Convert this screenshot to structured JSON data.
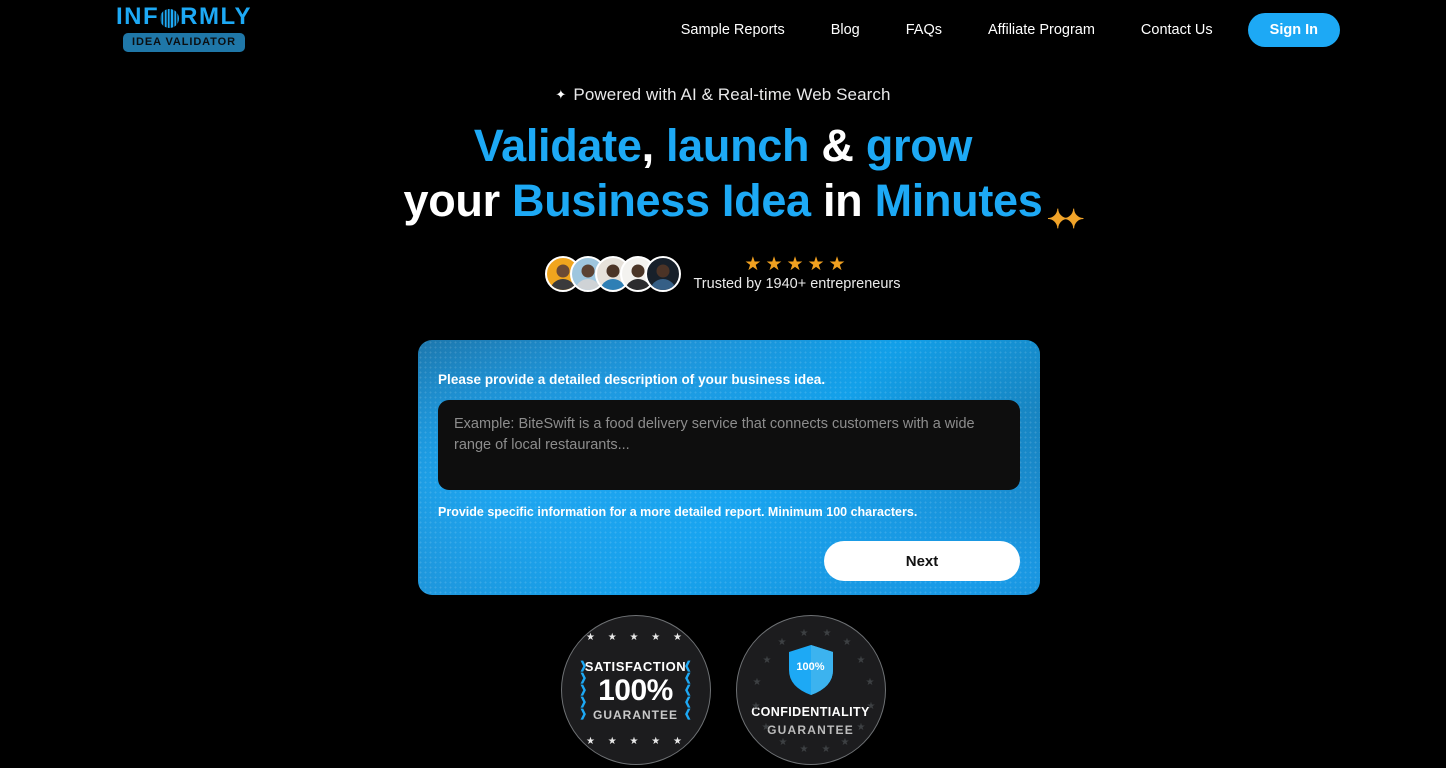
{
  "brand": {
    "name_part1": "INF",
    "globe_icon": "globe-icon",
    "name_part2": "RMLY",
    "badge": "IDEA VALIDATOR"
  },
  "nav": {
    "links": [
      {
        "label": "Sample Reports"
      },
      {
        "label": "Blog"
      },
      {
        "label": "FAQs"
      },
      {
        "label": "Affiliate Program"
      },
      {
        "label": "Contact Us"
      }
    ],
    "signin_label": "Sign In",
    "accent_color": "#1da9f5"
  },
  "hero": {
    "eyebrow_icon": "sparkle-icon",
    "eyebrow": "Powered with AI & Real-time Web Search",
    "headline": {
      "line1_w1": "Validate",
      "line1_sep1": ",",
      "line1_w2": "launch",
      "line1_amp": "&",
      "line1_w3": "grow",
      "line2_w1": "your",
      "line2_w2": "Business Idea",
      "line2_w3": "in",
      "line2_w4": "Minutes",
      "sparkle_icon": "sparkle-icon"
    },
    "accent_color": "#1da9f5"
  },
  "social_proof": {
    "avatars_label": "entrepreneur-avatars",
    "avatar_count": 5,
    "stars": "★★★★★",
    "star_count": 5,
    "star_color": "#f0a020",
    "trusted_text": "Trusted by 1940+ entrepreneurs"
  },
  "form_card": {
    "label": "Please provide a detailed description of your business idea.",
    "textarea_value": "",
    "textarea_placeholder": "Example: BiteSwift is a food delivery service that connects customers with a wide range of local restaurants...",
    "helper_text": "Provide specific information for a more detailed report. Minimum 100 characters.",
    "next_label": "Next",
    "gradient_from": "#1d6d9e",
    "gradient_to": "#129fe8"
  },
  "badges": {
    "satisfaction": {
      "stars_top": "★ ★ ★ ★ ★",
      "line1": "SATISFACTION",
      "percent": "100%",
      "line3": "GUARANTEE",
      "stars_bottom": "★ ★ ★ ★ ★",
      "laurel_icon": "laurel-wreath-icon",
      "accent_color": "#1da9f5"
    },
    "confidentiality": {
      "shield_icon": "shield-icon",
      "shield_text": "100%",
      "line1": "CONFIDENTIALITY",
      "line2": "GUARANTEE",
      "accent_color": "#1da9f5"
    }
  }
}
